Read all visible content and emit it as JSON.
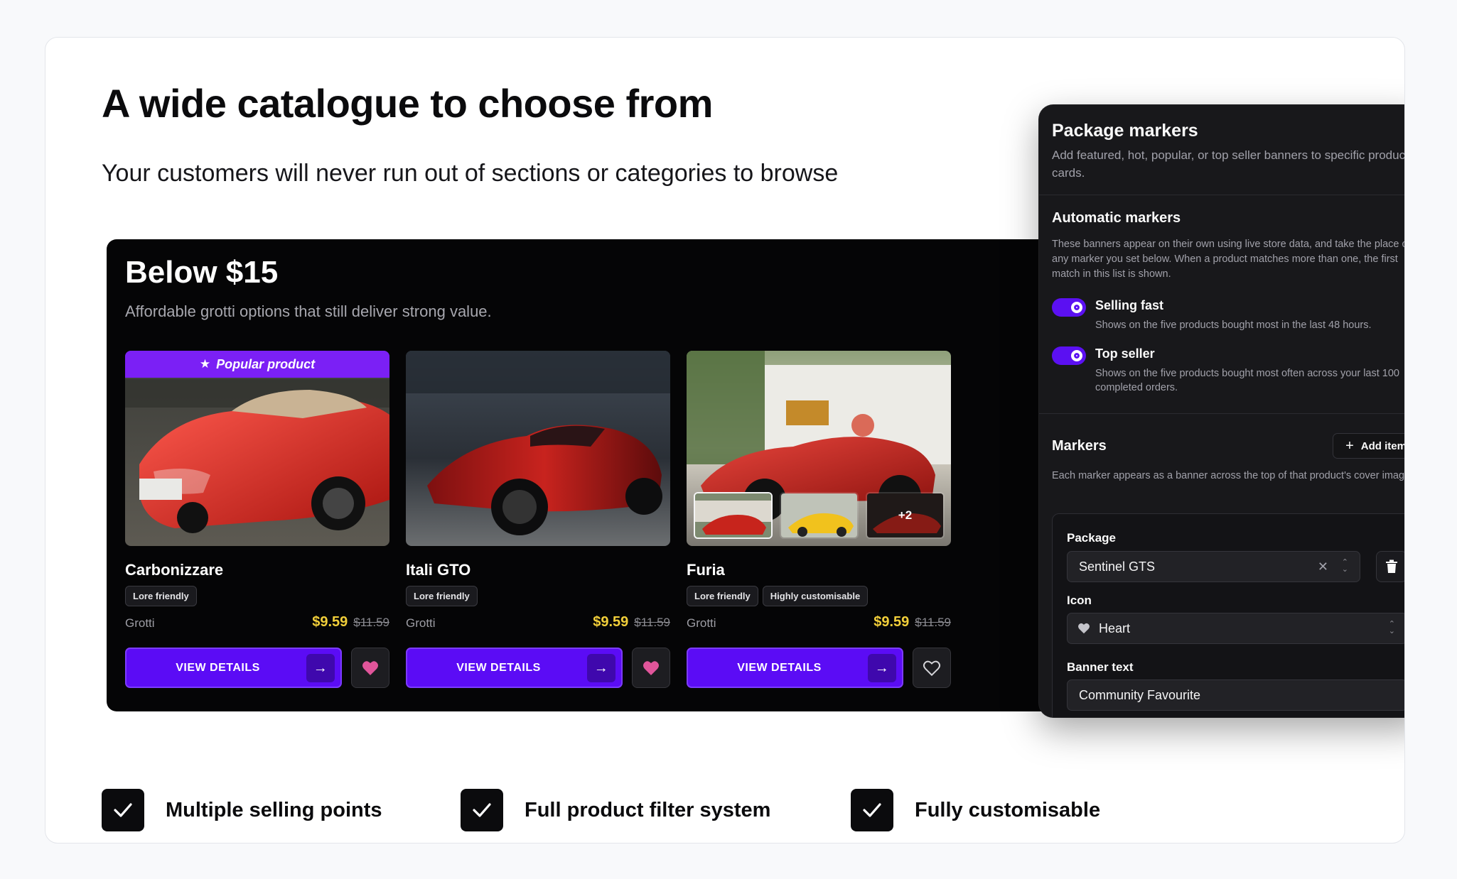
{
  "hero": {
    "title": "A wide catalogue to choose from",
    "subtitle": "Your customers will never run out of sections or categories to browse"
  },
  "store": {
    "title": "Below $15",
    "description": "Affordable grotti options that still deliver strong value.",
    "view_label": "VIEW DETAILS",
    "products": [
      {
        "name": "Carbonizzare",
        "banner": "Popular product",
        "tags": [
          "Lore friendly"
        ],
        "brand": "Grotti",
        "price": "$9.59",
        "old_price": "$11.59",
        "favourited": true
      },
      {
        "name": "Itali GTO",
        "tags": [
          "Lore friendly"
        ],
        "brand": "Grotti",
        "price": "$9.59",
        "old_price": "$11.59",
        "favourited": true
      },
      {
        "name": "Furia",
        "tags": [
          "Lore friendly",
          "Highly customisable"
        ],
        "brand": "Grotti",
        "price": "$9.59",
        "old_price": "$11.59",
        "favourited": false,
        "more_images": "+2"
      }
    ]
  },
  "panel": {
    "title": "Package markers",
    "description": "Add featured, hot, popular, or top seller banners to specific product cards.",
    "auto_title": "Automatic markers",
    "auto_desc": "These banners appear on their own using live store data, and take the place of any marker you set below. When a product matches more than one, the first match in this list is shown.",
    "toggles": [
      {
        "label": "Selling fast",
        "desc": "Shows on the five products bought most in the last 48 hours.",
        "on": true
      },
      {
        "label": "Top seller",
        "desc": "Shows on the five products bought most often across your last 100 completed orders.",
        "on": true
      }
    ],
    "markers_title": "Markers",
    "add_item": "Add item",
    "markers_desc": "Each marker appears as a banner across the top of that product's cover image.",
    "package_label": "Package",
    "package_value": "Sentinel GTS",
    "icon_label": "Icon",
    "icon_value": "Heart",
    "banner_label": "Banner text",
    "banner_value": "Community Favourite"
  },
  "features": [
    "Multiple selling points",
    "Full product filter system",
    "Fully customisable"
  ],
  "colors": {
    "accent": "#5b0cf5",
    "banner": "#7b20f5",
    "price": "#f2cf3a",
    "favourite": "#e0559a"
  }
}
